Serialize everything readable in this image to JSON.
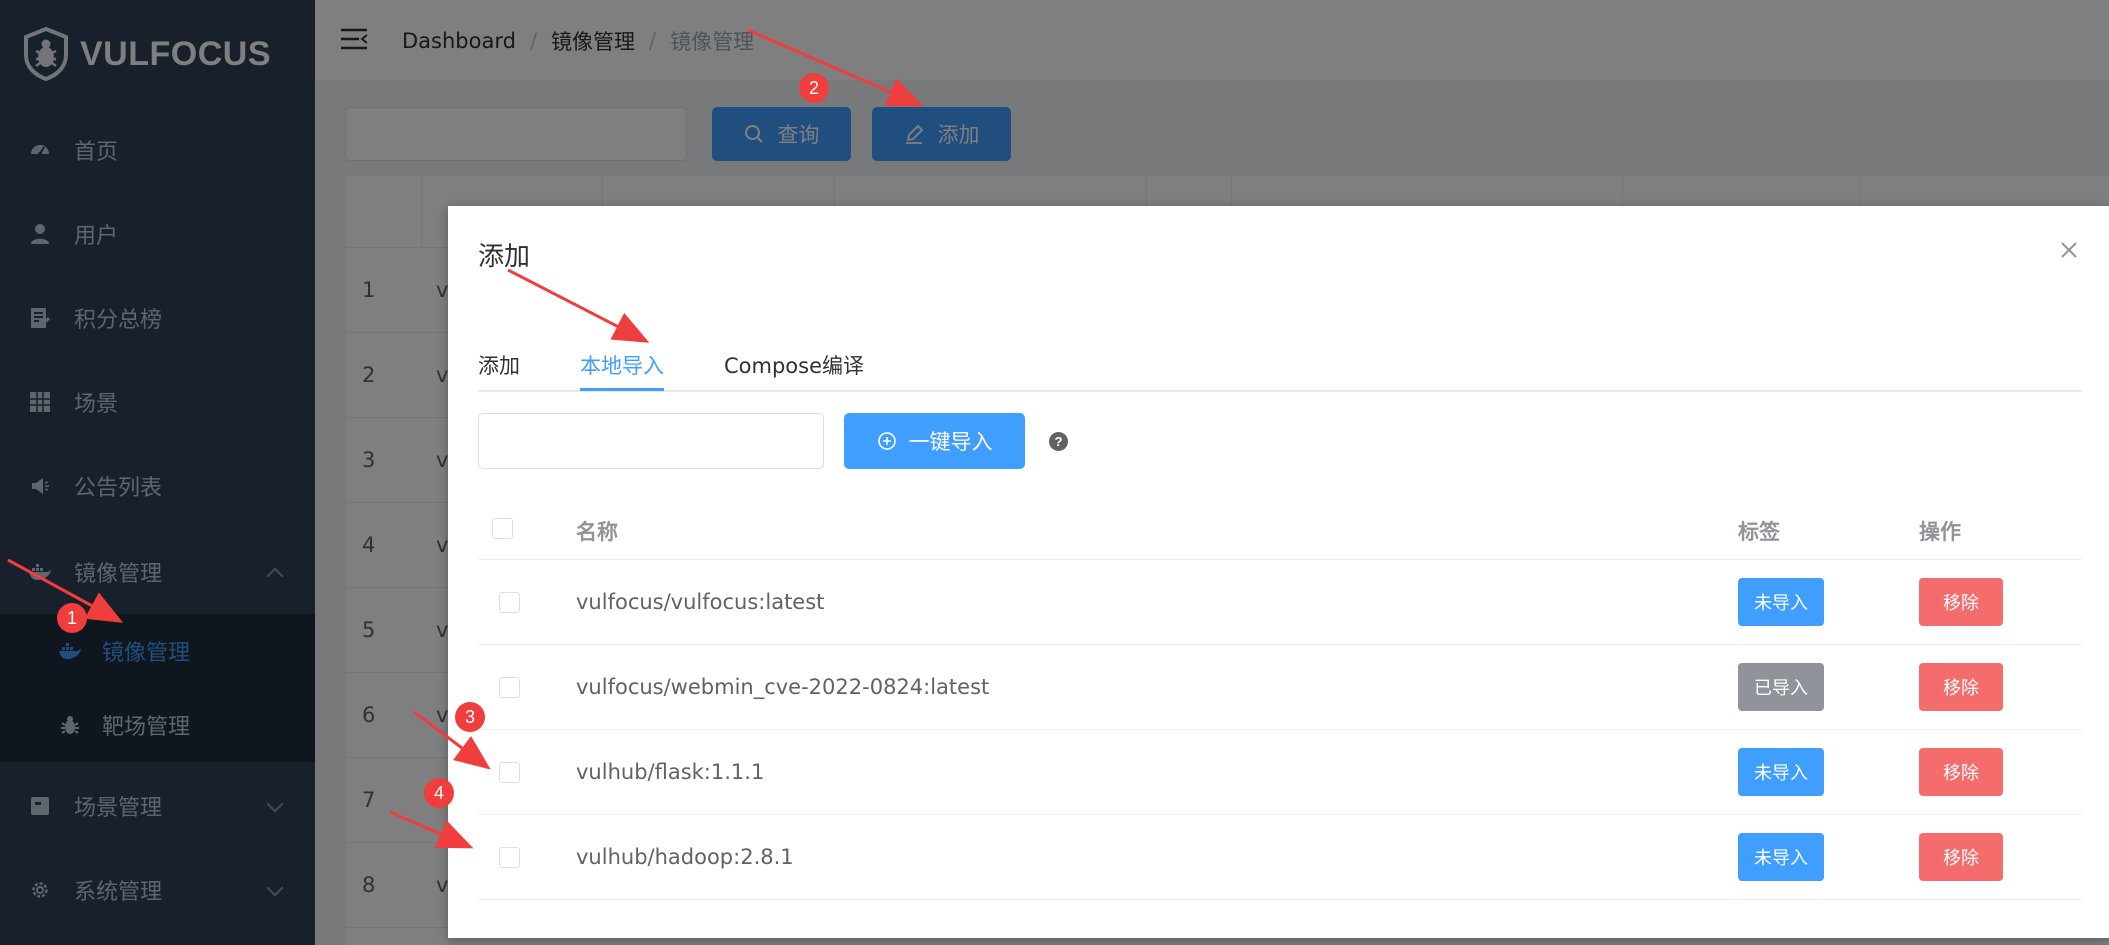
{
  "logo": {
    "text": "VULFOCUS"
  },
  "sidebar": {
    "items": [
      {
        "label": "首页",
        "icon": "dashboard-icon"
      },
      {
        "label": "用户",
        "icon": "user-icon"
      },
      {
        "label": "积分总榜",
        "icon": "edit-doc-icon"
      },
      {
        "label": "场景",
        "icon": "grid-icon"
      },
      {
        "label": "公告列表",
        "icon": "megaphone-icon"
      },
      {
        "label": "镜像管理",
        "icon": "docker-icon",
        "expanded": true
      },
      {
        "label": "场景管理",
        "icon": "scene-icon"
      },
      {
        "label": "系统管理",
        "icon": "gear-icon"
      }
    ],
    "subitems": [
      {
        "label": "镜像管理",
        "icon": "docker-icon",
        "active": true
      },
      {
        "label": "靶场管理",
        "icon": "bug-icon"
      }
    ]
  },
  "breadcrumb": {
    "items": [
      "Dashboard",
      "镜像管理",
      "镜像管理"
    ],
    "separator": "/"
  },
  "toolbar": {
    "query_label": "查询",
    "add_label": "添加"
  },
  "bg_table": {
    "row_numbers": [
      "1",
      "2",
      "3",
      "4",
      "5",
      "6",
      "7",
      "8"
    ],
    "cell_prefix": "v"
  },
  "dialog": {
    "title": "添加",
    "tabs": [
      {
        "label": "添加",
        "active": false
      },
      {
        "label": "本地导入",
        "active": true
      },
      {
        "label": "Compose编译",
        "active": false
      }
    ],
    "import_label": "一键导入",
    "help_mark": "?",
    "table": {
      "headers": {
        "name": "名称",
        "tag": "标签",
        "action": "操作"
      },
      "rows": [
        {
          "name": "vulfocus/vulfocus:latest",
          "tag": "未导入",
          "tag_color": "#409eff",
          "action": "移除"
        },
        {
          "name": "vulfocus/webmin_cve-2022-0824:latest",
          "tag": "已导入",
          "tag_color": "#909399",
          "action": "移除"
        },
        {
          "name": "vulhub/flask:1.1.1",
          "tag": "未导入",
          "tag_color": "#409eff",
          "action": "移除"
        },
        {
          "name": "vulhub/hadoop:2.8.1",
          "tag": "未导入",
          "tag_color": "#409eff",
          "action": "移除"
        }
      ]
    }
  },
  "annotations": {
    "badges": [
      "1",
      "2",
      "3",
      "4"
    ],
    "color": "#f03d3d"
  },
  "colors": {
    "primary": "#409eff",
    "sidebar": "#304156",
    "danger": "#f56c6c",
    "info": "#909399"
  }
}
